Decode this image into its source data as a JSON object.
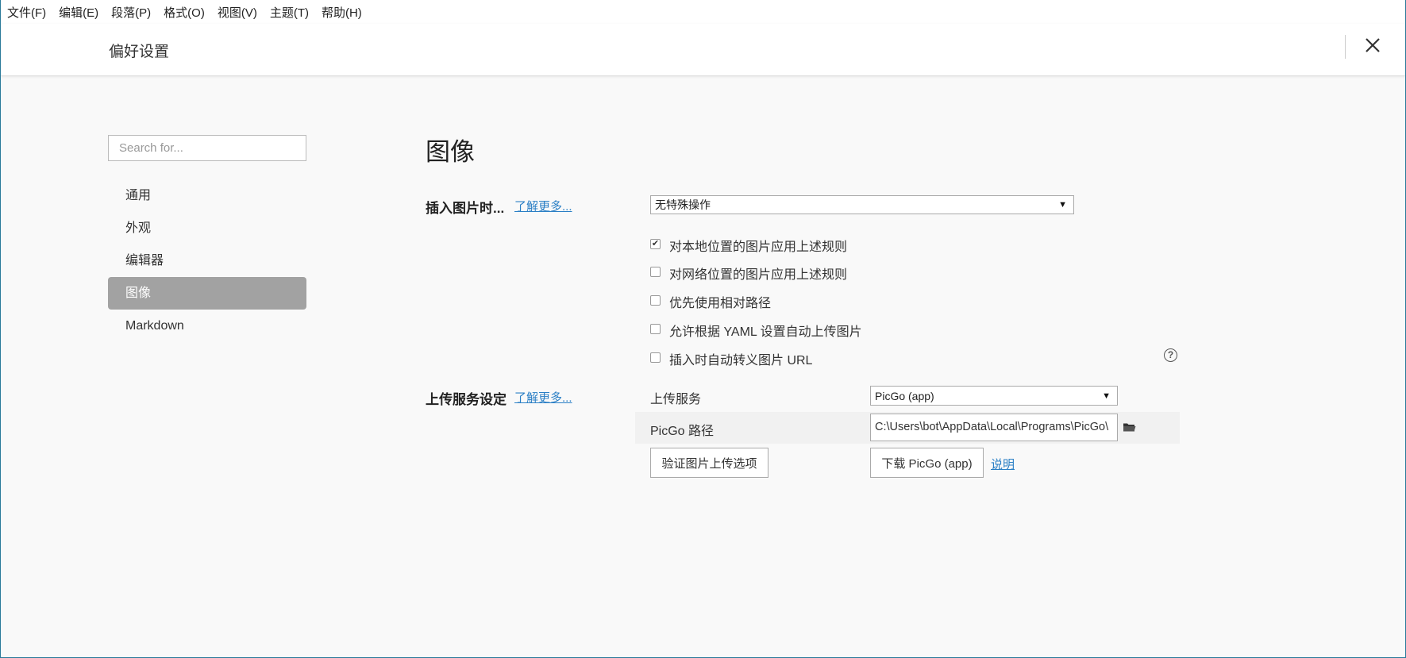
{
  "menubar": {
    "items": [
      "文件(F)",
      "编辑(E)",
      "段落(P)",
      "格式(O)",
      "视图(V)",
      "主题(T)",
      "帮助(H)"
    ]
  },
  "header": {
    "title": "偏好设置",
    "close_icon": "close-icon"
  },
  "sidebar": {
    "search_placeholder": "Search for...",
    "items": [
      {
        "label": "通用",
        "active": false
      },
      {
        "label": "外观",
        "active": false
      },
      {
        "label": "编辑器",
        "active": false
      },
      {
        "label": "图像",
        "active": true
      },
      {
        "label": "Markdown",
        "active": false
      }
    ]
  },
  "main": {
    "section_title": "图像",
    "insert_image": {
      "label": "插入图片时...",
      "learn_more": "了解更多...",
      "select_value": "无特殊操作",
      "checkboxes": [
        {
          "label": "对本地位置的图片应用上述规则",
          "checked": true
        },
        {
          "label": "对网络位置的图片应用上述规则",
          "checked": false
        },
        {
          "label": "优先使用相对路径",
          "checked": false
        },
        {
          "label": "允许根据 YAML 设置自动上传图片",
          "checked": false
        },
        {
          "label": "插入时自动转义图片 URL",
          "checked": false
        }
      ],
      "help_icon": "question-circle-icon"
    },
    "upload": {
      "label": "上传服务设定",
      "learn_more": "了解更多...",
      "service_label": "上传服务",
      "service_value": "PicGo (app)",
      "path_label": "PicGo 路径",
      "path_value": "C:\\Users\\bot\\AppData\\Local\\Programs\\PicGo\\",
      "folder_icon": "folder-icon",
      "verify_button": "验证图片上传选项",
      "download_button": "下载 PicGo (app)",
      "doc_link": "说明"
    }
  }
}
